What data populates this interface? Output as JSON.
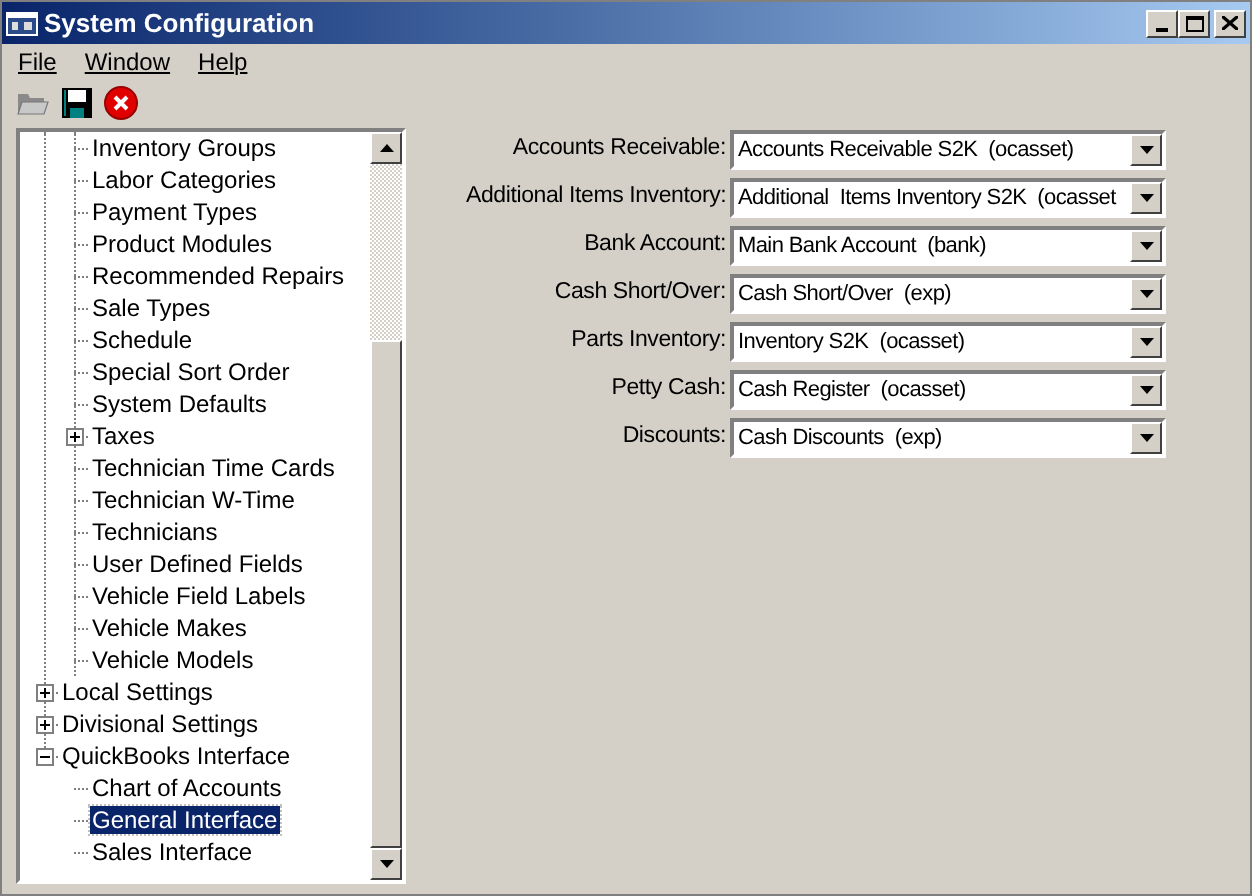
{
  "window": {
    "title": "System Configuration"
  },
  "menu": [
    "File",
    "Window",
    "Help"
  ],
  "tree": {
    "hidden_parent_children": [
      {
        "label": "Inventory Groups",
        "selected": false
      },
      {
        "label": "Labor Categories",
        "selected": false
      },
      {
        "label": "Payment Types",
        "selected": false
      },
      {
        "label": "Product Modules",
        "selected": false
      },
      {
        "label": "Recommended Repairs",
        "selected": false
      },
      {
        "label": "Sale Types",
        "selected": false
      },
      {
        "label": "Schedule",
        "selected": false
      },
      {
        "label": "Special Sort Order",
        "selected": false
      },
      {
        "label": "System Defaults",
        "selected": false
      },
      {
        "label": "Taxes",
        "selected": false,
        "expanded": false
      },
      {
        "label": "Technician Time Cards",
        "selected": false
      },
      {
        "label": "Technician W-Time",
        "selected": false
      },
      {
        "label": "Technicians",
        "selected": false
      },
      {
        "label": "User Defined Fields",
        "selected": false
      },
      {
        "label": "Vehicle Field Labels",
        "selected": false
      },
      {
        "label": "Vehicle Makes",
        "selected": false
      },
      {
        "label": "Vehicle Models",
        "selected": false
      }
    ],
    "items": [
      {
        "label": "Local Settings",
        "selected": false,
        "expanded": false
      },
      {
        "label": "Divisional Settings",
        "selected": false,
        "expanded": false
      },
      {
        "label": "QuickBooks Interface",
        "selected": false,
        "expanded": true,
        "children": [
          {
            "label": "Chart of Accounts",
            "selected": false
          },
          {
            "label": "General Interface",
            "selected": true
          },
          {
            "label": "Sales Interface",
            "selected": false
          }
        ]
      }
    ]
  },
  "fields": [
    {
      "label": "Accounts Receivable:",
      "value": "Accounts Receivable S2K  (ocasset)"
    },
    {
      "label": "Additional Items Inventory:",
      "value": "Additional  Items Inventory S2K  (ocasset"
    },
    {
      "label": "Bank Account:",
      "value": "Main Bank Account  (bank)"
    },
    {
      "label": "Cash Short/Over:",
      "value": "Cash Short/Over  (exp)"
    },
    {
      "label": "Parts Inventory:",
      "value": "Inventory S2K  (ocasset)"
    },
    {
      "label": "Petty Cash:",
      "value": "Cash Register  (ocasset)"
    },
    {
      "label": "Discounts:",
      "value": "Cash Discounts  (exp)"
    }
  ]
}
